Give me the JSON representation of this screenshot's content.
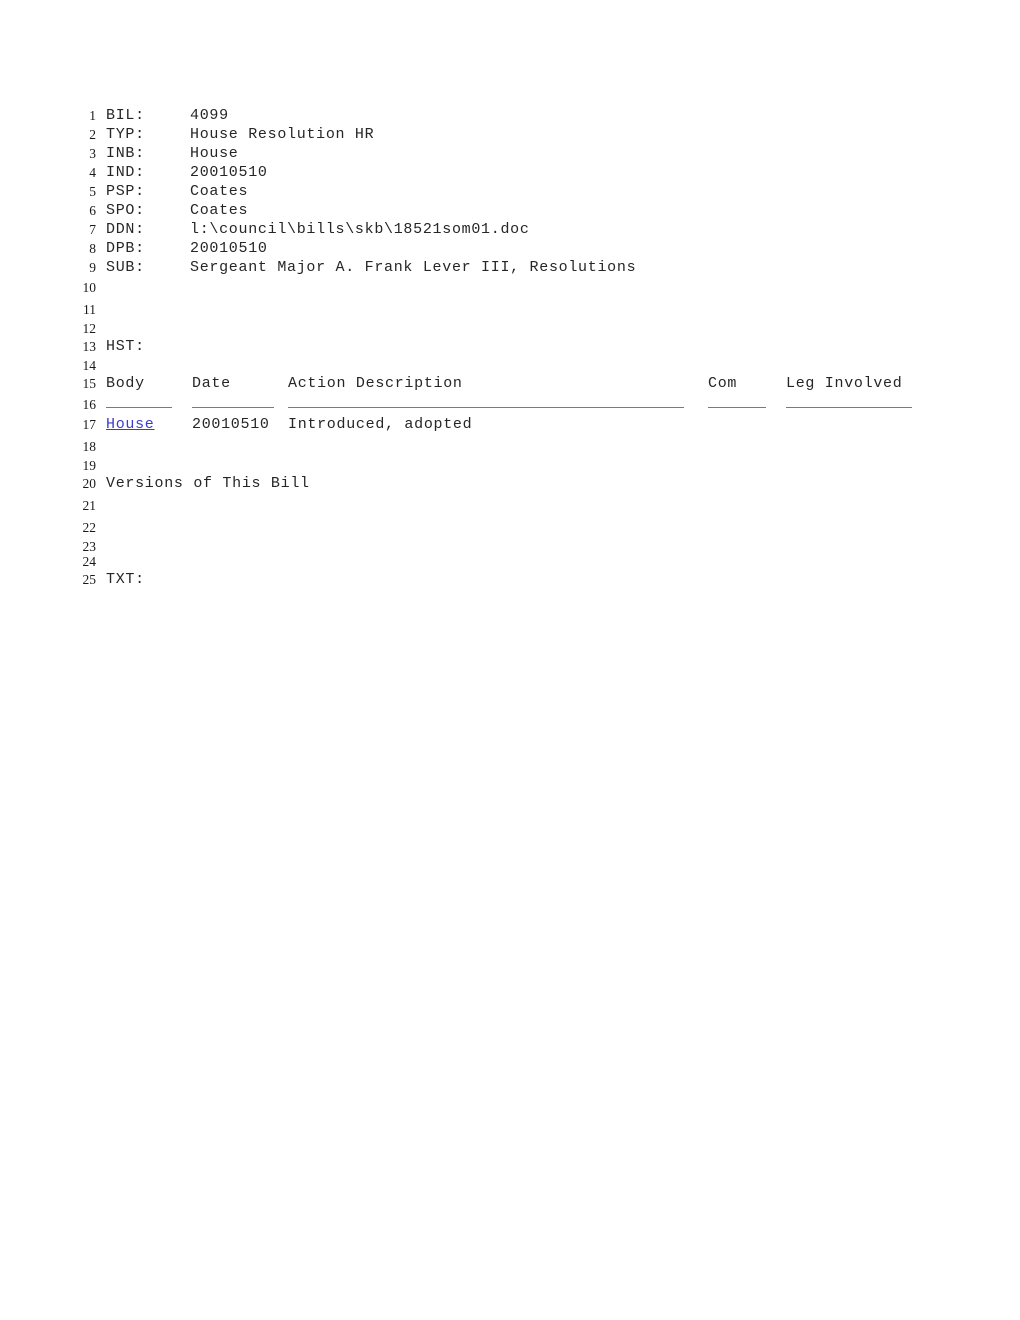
{
  "document": {
    "title": "Bill 4099 - House Resolution",
    "link_color": "#3b3bd1",
    "text_color": "#262626"
  },
  "fields": [
    {
      "line": "1",
      "label": "BIL:",
      "value": "4099"
    },
    {
      "line": "2",
      "label": "TYP:",
      "value": "House Resolution HR"
    },
    {
      "line": "3",
      "label": "INB:",
      "value": "House"
    },
    {
      "line": "4",
      "label": "IND:",
      "value": "20010510"
    },
    {
      "line": "5",
      "label": "PSP:",
      "value": "Coates"
    },
    {
      "line": "6",
      "label": "SPO:",
      "value": "Coates"
    },
    {
      "line": "7",
      "label": "DDN:",
      "value": "l:\\council\\bills\\skb\\18521som01.doc"
    },
    {
      "line": "8",
      "label": "DPB:",
      "value": "20010510"
    },
    {
      "line": "9",
      "label": "SUB:",
      "value": "Sergeant Major A. Frank Lever III, Resolutions"
    }
  ],
  "blank_lines_a": [
    {
      "line": "10"
    },
    {
      "line": "11"
    },
    {
      "line": "12"
    }
  ],
  "history": {
    "heading_line": "13",
    "heading": "HST:",
    "blank_line": "14",
    "header_line": "15",
    "rule_line": "16",
    "columns": {
      "body": "Body",
      "date": "Date",
      "action": "Action Description",
      "com": "Com",
      "leg": "Leg Involved"
    },
    "rows": [
      {
        "line": "17",
        "body": "House",
        "body_is_link": true,
        "date": "20010510",
        "action": "Introduced, adopted",
        "com": "",
        "leg": ""
      }
    ]
  },
  "blank_lines_b": [
    {
      "line": "18"
    },
    {
      "line": "19"
    }
  ],
  "versions": {
    "line": "20",
    "label": "Versions of This Bill"
  },
  "blank_lines_c": [
    {
      "line": "21"
    },
    {
      "line": "22"
    },
    {
      "line": "23"
    },
    {
      "line": "24"
    }
  ],
  "text_section": {
    "line": "25",
    "label": "TXT:"
  }
}
